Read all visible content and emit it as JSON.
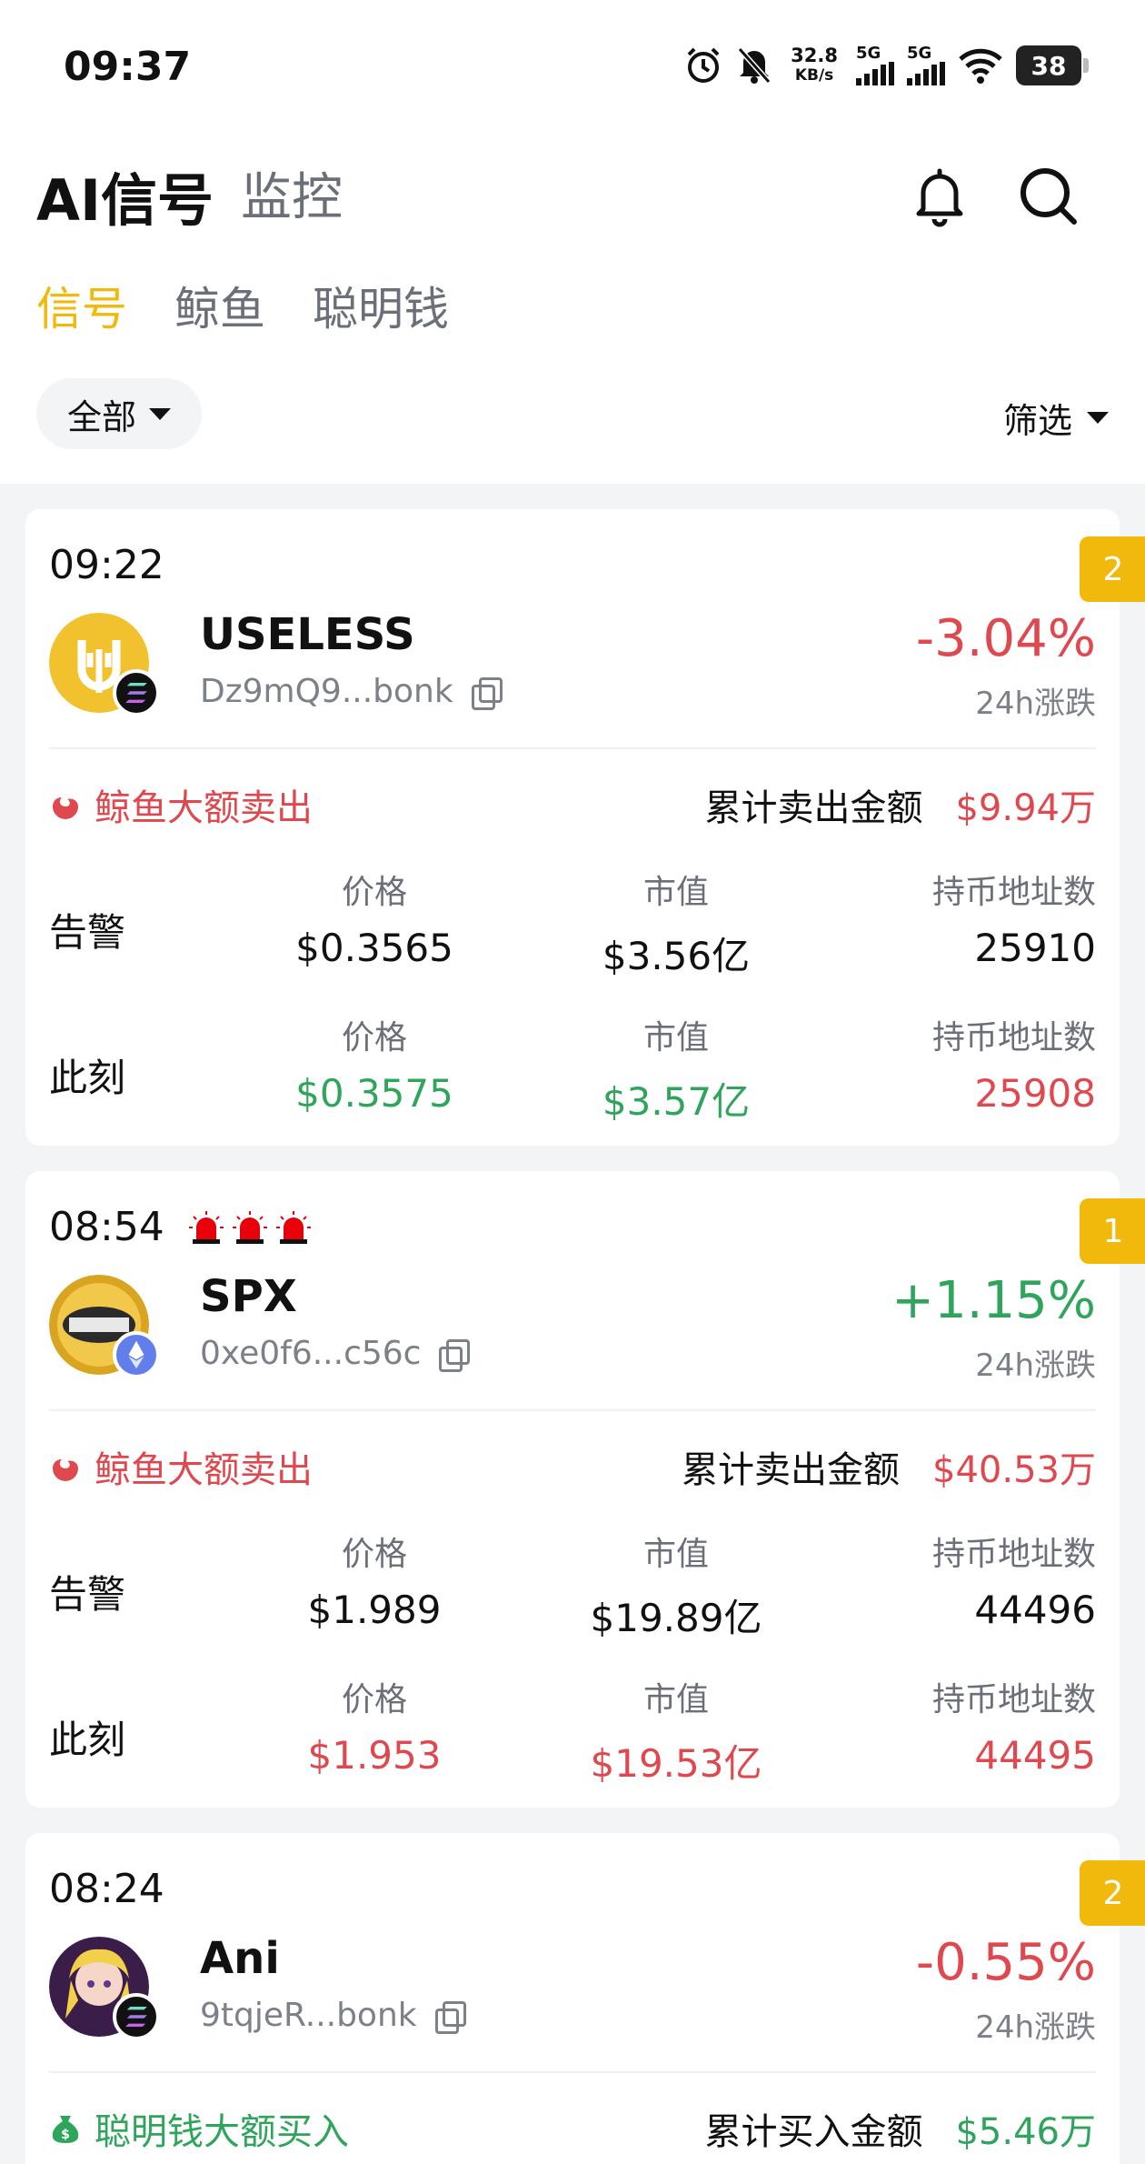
{
  "status_bar": {
    "time": "09:37",
    "net_speed_value": "32.8",
    "net_speed_unit": "KB/s",
    "sig1": "5G",
    "sig2": "5G",
    "battery": "38"
  },
  "header": {
    "title": "AI信号",
    "tab_monitor": "监控"
  },
  "tabs": [
    "信号",
    "鲸鱼",
    "聪明钱"
  ],
  "filters": {
    "all_label": "全部",
    "filter_label": "筛选"
  },
  "labels": {
    "change_24h": "24h涨跌",
    "alert": "告警",
    "now": "此刻",
    "price": "价格",
    "mcap": "市值",
    "holders": "持币地址数"
  },
  "cards": [
    {
      "time": "09:22",
      "badge": "2",
      "name": "USELESS",
      "address": "Dz9mQ9...bonk",
      "change": "-3.04%",
      "change_color": "#e0484f",
      "event": "鲸鱼大额卖出",
      "cum_label": "累计卖出金额",
      "cum_value": "$9.94万",
      "alert": {
        "price": "$0.3565",
        "mcap": "$3.56亿",
        "holders": "25910"
      },
      "now": {
        "price": "$0.3575",
        "mcap": "$3.57亿",
        "holders": "25908"
      },
      "chain": "solana"
    },
    {
      "time": "08:54",
      "badge": "1",
      "name": "SPX",
      "address": "0xe0f6...c56c",
      "change": "+1.15%",
      "change_color": "#2ea55a",
      "event": "鲸鱼大额卖出",
      "cum_label": "累计卖出金额",
      "cum_value": "$40.53万",
      "alert": {
        "price": "$1.989",
        "mcap": "$19.89亿",
        "holders": "44496"
      },
      "now": {
        "price": "$1.953",
        "mcap": "$19.53亿",
        "holders": "44495"
      },
      "chain": "ethereum"
    },
    {
      "time": "08:24",
      "badge": "2",
      "name": "Ani",
      "address": "9tqjeR...bonk",
      "change": "-0.55%",
      "change_color": "#e0484f",
      "event": "聪明钱大额买入",
      "cum_label": "累计买入金额",
      "cum_value": "$5.46万",
      "chain": "solana"
    }
  ]
}
